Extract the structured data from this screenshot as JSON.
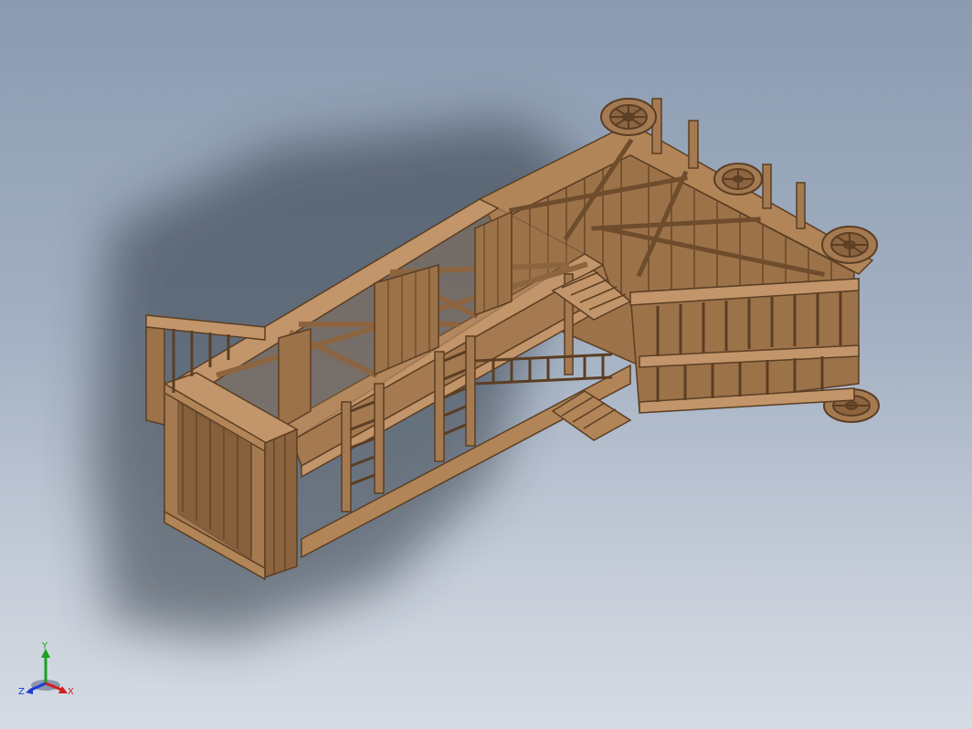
{
  "viewport": {
    "background_top": "#8b9bb0",
    "background_bottom": "#d6dce4",
    "model": {
      "kind": "wooden siege structure (isometric 3D render)",
      "wood_color": "#a57a51",
      "wood_dark": "#6e4c2c",
      "wood_light": "#c2956a"
    }
  },
  "triad": {
    "x_label": "X",
    "y_label": "Y",
    "z_label": "Z",
    "x_color": "#d21e1e",
    "y_color": "#1ea01e",
    "z_color": "#1e3cd2"
  }
}
